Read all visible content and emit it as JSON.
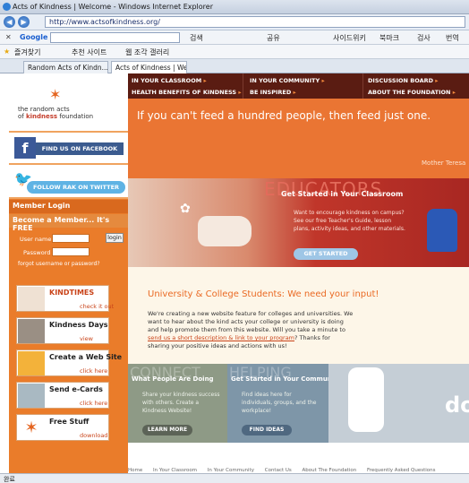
{
  "browser": {
    "window_title": "Acts of Kindness | Welcome - Windows Internet Explorer",
    "url": "http://www.actsofkindness.org/",
    "google_label": "Google",
    "google_items": [
      "검색",
      "공유",
      "사이드위키",
      "북마크",
      "검사",
      "번역"
    ],
    "favorites": [
      "즐겨찾기",
      "추천 사이트",
      "웹 조각 갤러리"
    ],
    "tabs": [
      "Random Acts of Kindn...",
      "Acts of Kindness | Wel..."
    ],
    "status_text": "완료"
  },
  "logo": {
    "line1": "the random acts",
    "line2a": "of",
    "line2b": "kindness",
    "line2c": "foundation"
  },
  "sidebar": {
    "facebook_btn": "FIND US ON FACEBOOK",
    "twitter_btn": "FOLLOW RAK ON TWITTER",
    "member_login": "Member Login",
    "become_member": "Become a Member... It's FREE",
    "username_label": "User name",
    "password_label": "Password",
    "login_btn": "login",
    "forgot": "forgot username or password?",
    "cards": [
      {
        "title": "KINDTIMES",
        "sub": "check it out"
      },
      {
        "title": "Kindness Days",
        "sub": "view"
      },
      {
        "title": "Create a Web Site",
        "sub": "click here"
      },
      {
        "title": "Send e-Cards",
        "sub": "click here"
      },
      {
        "title": "Free Stuff",
        "sub": "download"
      }
    ]
  },
  "nav": {
    "items": [
      "IN YOUR CLASSROOM",
      "IN YOUR COMMUNITY",
      "DISCUSSION BOARD",
      "HEALTH BENEFITS OF KINDNESS",
      "BE INSPIRED",
      "ABOUT THE FOUNDATION"
    ]
  },
  "hero": {
    "quote": "If you can't feed a hundred people, then feed just one.",
    "author": "Mother Teresa"
  },
  "educators": {
    "watermark": "EDUCATORS",
    "heading": "Get Started in Your Classroom",
    "text": "Want to encourage kindness on campus? See our free Teacher's Guide, lesson plans, activity ideas, and other materials.",
    "button": "GET STARTED"
  },
  "university": {
    "heading": "University & College Students: We need your input!",
    "text_before": "We're creating a new website feature for colleges and universities. We want to hear about the kind acts your college or university is doing and help promote them from this website. Will you take a minute to",
    "link": "send us a short description & link to your program",
    "text_after": "? Thanks for sharing your positive ideas and actions with us!"
  },
  "boxes": [
    {
      "watermark": "CONNECT",
      "heading": "What People Are Doing",
      "text": "Share your kindness success with others. Create a Kindness Website!",
      "button": "LEARN MORE"
    },
    {
      "watermark": "HELPING",
      "heading": "Get Started in Your Community",
      "text": "Find ideas here for individuals, groups, and the workplace!",
      "button": "FIND IDEAS"
    }
  ],
  "box3_text": "do",
  "footer": [
    "Home",
    "In Your Classroom",
    "In Your Community",
    "Contact Us",
    "About The Foundation",
    "Frequently Asked Questions"
  ]
}
